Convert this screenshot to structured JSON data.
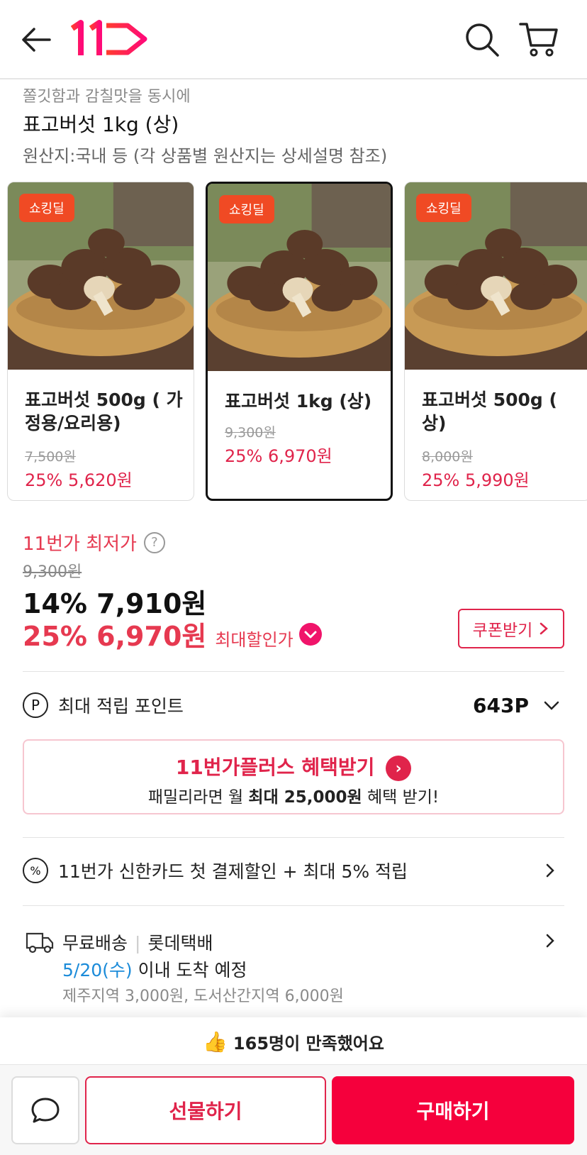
{
  "header": {
    "back_icon": "back-arrow-icon",
    "logo_text": "11",
    "search_icon": "search-icon",
    "cart_icon": "cart-icon"
  },
  "product": {
    "subtitle": "쫄깃함과 감칠맛을 동시에",
    "title": "표고버섯 1kg (상)",
    "origin": "원산지:국내 등 (각 상품별 원산지는 상세설명 참조)"
  },
  "options": [
    {
      "badge": "쇼킹딜",
      "name": "표고버섯 500g ( 가정용/요리용)",
      "original_price": "7,500원",
      "sale": "25% 5,620원",
      "selected": false
    },
    {
      "badge": "쇼킹딜",
      "name": "표고버섯 1kg (상)",
      "original_price": "9,300원",
      "sale": "25% 6,970원",
      "selected": true
    },
    {
      "badge": "쇼킹딜",
      "name": "표고버섯 500g ( 상)",
      "original_price": "8,000원",
      "sale": "25% 5,990원",
      "selected": false
    }
  ],
  "price": {
    "lowest_label": "11번가 최저가",
    "help_symbol": "?",
    "original": "9,300원",
    "discount_price": "14% 7,910원",
    "max_discount_price": "25% 6,970원",
    "max_discount_label": "최대할인가",
    "coupon_label": "쿠폰받기"
  },
  "points": {
    "icon_letter": "P",
    "label": "최대 적립 포인트",
    "value": "643P"
  },
  "plus_banner": {
    "title": "11번가플러스 혜택받기",
    "desc_prefix": "패밀리라면 월 ",
    "desc_bold": "최대 25,000원",
    "desc_suffix": " 혜택 받기!"
  },
  "card_promo": {
    "icon_symbol": "%",
    "text": "11번가 신한카드 첫 결제할인 + 최대 5% 적립"
  },
  "delivery": {
    "type": "무료배송",
    "carrier": "롯데택배",
    "date": "5/20(수)",
    "date_suffix": " 이내 도착 예정",
    "extra": "제주지역 3,000원, 도서산간지역 6,000원"
  },
  "satisfaction": {
    "icon": "thumbs-up-icon",
    "text": "165명이 만족했어요"
  },
  "bottom": {
    "chat_icon": "chat-bubble-icon",
    "gift_label": "선물하기",
    "buy_label": "구매하기"
  },
  "colors": {
    "accent": "#e0244b",
    "buy_bg": "#f5003c",
    "badge": "#f04a24",
    "delivery_date": "#1b8bd9"
  }
}
